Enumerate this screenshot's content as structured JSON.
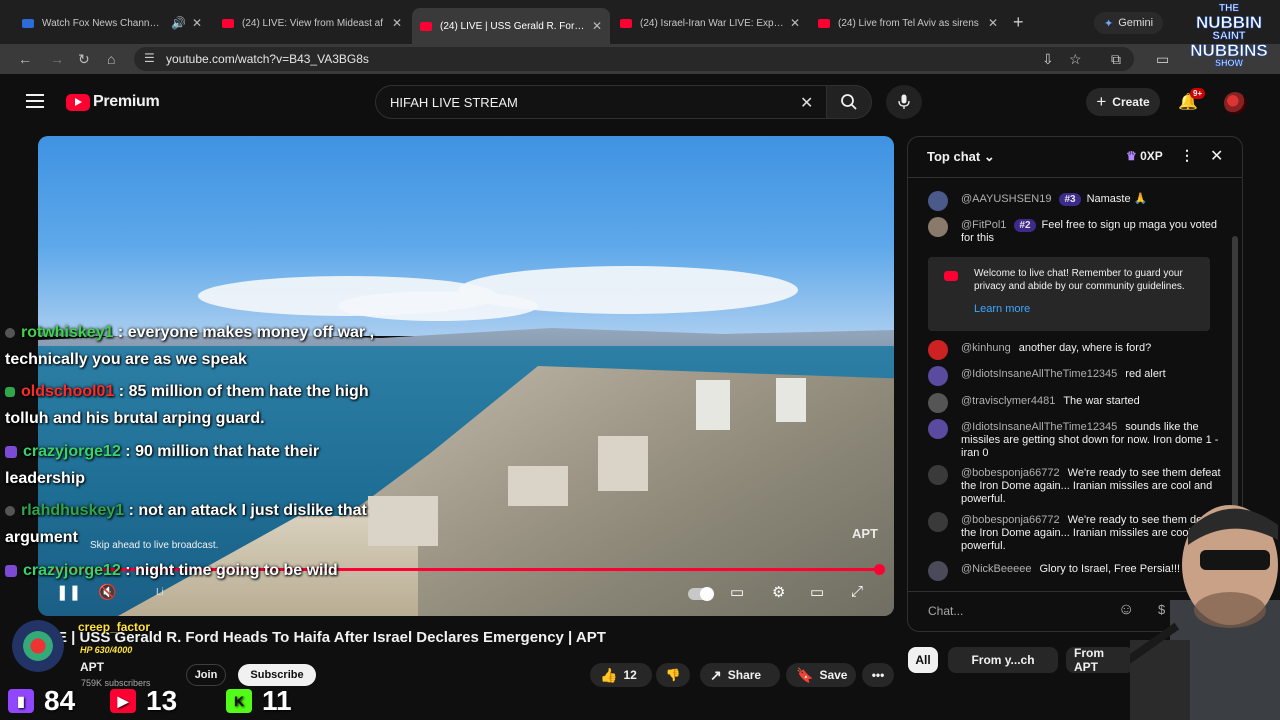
{
  "browser": {
    "tabs": [
      {
        "title": "Watch Fox News Channel O",
        "icon_color": "#2b6cd8"
      },
      {
        "title": "(24) LIVE: View from Mideast af",
        "icon_color": "#ff0033"
      },
      {
        "title": "(24) LIVE | USS Gerald R. Ford H",
        "icon_color": "#ff0033",
        "active": true
      },
      {
        "title": "(24) Israel-Iran War LIVE: Explos",
        "icon_color": "#ff0033"
      },
      {
        "title": "(24) Live from Tel Aviv as sirens",
        "icon_color": "#ff0033"
      }
    ],
    "gemini_label": "Gemini",
    "url": "youtube.com/watch?v=B43_VA3BG8s"
  },
  "overlay_logo": {
    "line1": "THE",
    "line2": "NUBBIN",
    "line3": "SAINT",
    "line4": "NUBBINS",
    "line5": "SHOW"
  },
  "youtube": {
    "brand_label": "Premium",
    "search_value": "HIFAH LIVE STREAM",
    "create_label": "Create",
    "notif_badge": "9+"
  },
  "player": {
    "skip_tooltip": "Skip ahead to live broadcast.",
    "watermark": "APT",
    "live_label": "Li",
    "progress": 1.0
  },
  "overlay_chat": [
    {
      "user": "rotwhiskey1",
      "user_color": "#3fd24a",
      "text": " : everyone makes money off war , technically you are as we speak"
    },
    {
      "user": "oldschool01",
      "user_color": "#ff2a2a",
      "text": " : 85 million of them hate the high tolluh and his brutal arping guard."
    },
    {
      "user": "crazyjorge12",
      "user_color": "#39d36a",
      "text": " : 90 million that hate their leadership"
    },
    {
      "user": "rlahdhuskey1",
      "user_color": "#2fa64a",
      "text": " : not an attack I just dislike that argument"
    },
    {
      "user": "crazyjorge12",
      "user_color": "#39d36a",
      "text": " : night time going to be wild"
    }
  ],
  "video": {
    "title": "E | USS Gerald R. Ford Heads To Haifa After Israel Declares Emergency | APT",
    "channel_name": "APT",
    "subscribers": "759K subscribers",
    "join_label": "Join",
    "subscribe_label": "Subscribe",
    "like_count": "12",
    "share_label": "Share",
    "save_label": "Save"
  },
  "streamer_overlay": {
    "viewer_name": "creep_factor",
    "hp_text": "HP 630/4000",
    "stats": [
      {
        "platform": "twitch",
        "color": "#9146ff",
        "count": "84"
      },
      {
        "platform": "youtube",
        "color": "#ff0033",
        "count": "13"
      },
      {
        "platform": "kick",
        "color": "#53fc18",
        "count": "11"
      }
    ]
  },
  "chat": {
    "title": "Top chat",
    "xp": "0XP",
    "messages": [
      {
        "user": "@AAYUSHSEN19",
        "rank": "#3",
        "text": "Namaste 🙏"
      },
      {
        "user": "@FitPol1",
        "rank": "#2",
        "text": "Feel free to sign up maga you voted for this"
      },
      {
        "user": "@kinhung",
        "text": "another day, where is ford?"
      },
      {
        "user": "@IdiotsInsaneAllTheTime12345",
        "text": "red alert"
      },
      {
        "user": "@travisclymer4481",
        "text": "The war started"
      },
      {
        "user": "@IdiotsInsaneAllTheTime12345",
        "text": "sounds like the missiles are getting shot down for now. Iron dome 1 - iran 0"
      },
      {
        "user": "@bobesponja66772",
        "text": "We're ready to see them defeat the Iron Dome again... Iranian missiles are cool and powerful."
      },
      {
        "user": "@bobesponja66772",
        "text": "We're ready to see them defeat the Iron Dome again... Iranian missiles are cool and powerful."
      },
      {
        "user": "@NickBeeeee",
        "text": "Glory to Israel, Free Persia!!!"
      }
    ],
    "welcome_text": "Welcome to live chat! Remember to guard your privacy and abide by our community guidelines.",
    "learn_more": "Learn more",
    "input_placeholder": "Chat..."
  },
  "filter_chips": [
    {
      "label": "All",
      "selected": true
    },
    {
      "label": "From y...ch"
    },
    {
      "label": "From APT"
    }
  ]
}
